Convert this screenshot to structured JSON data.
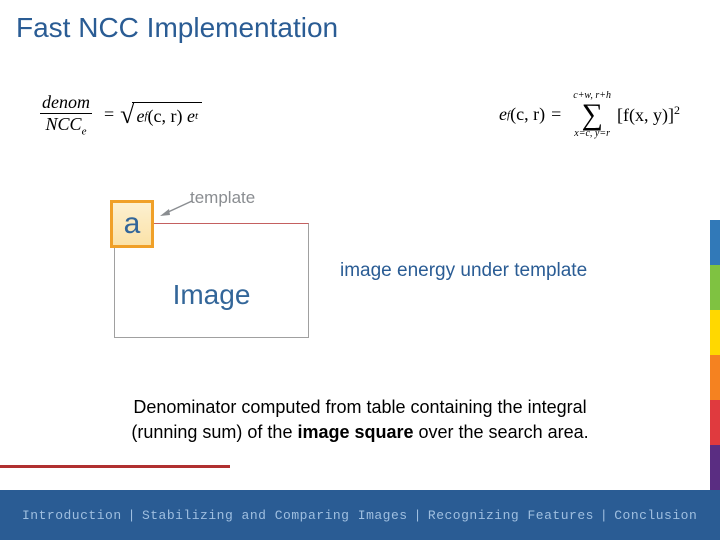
{
  "title": "Fast NCC Implementation",
  "formulas": {
    "left_frac_top": "denom",
    "left_frac_bot": "NCC",
    "left_frac_bot_sub": "e",
    "left_sqrt_a": "e",
    "left_sqrt_a_sub": "f",
    "left_sqrt_args": "(c, r)",
    "left_sqrt_b": "e",
    "left_sqrt_b_sub": "t",
    "right_lhs": "e",
    "right_lhs_sub": "f",
    "right_lhs_args": "(c, r)",
    "right_sum_top": "c+w, r+h",
    "right_sum_bot": "x=c, y=r",
    "right_fn": "[f(x, y)]",
    "right_exp": "2"
  },
  "diagram": {
    "template_letter": "a",
    "template_label": "template",
    "image_label": "Image"
  },
  "caption_right": "image energy under template",
  "body_text_1": "Denominator computed from table containing the integral",
  "body_text_2": "(running sum) of the ",
  "body_text_bold": "image square",
  "body_text_3": " over the search area.",
  "footer": {
    "items": [
      "Introduction",
      "Stabilizing and Comparing Images",
      "Recognizing Features",
      "Conclusion"
    ],
    "sep": "|"
  },
  "strip_colors": [
    "#3179b8",
    "#7fc241",
    "#ffd800",
    "#f58220",
    "#e03a3e",
    "#5a2d82"
  ]
}
